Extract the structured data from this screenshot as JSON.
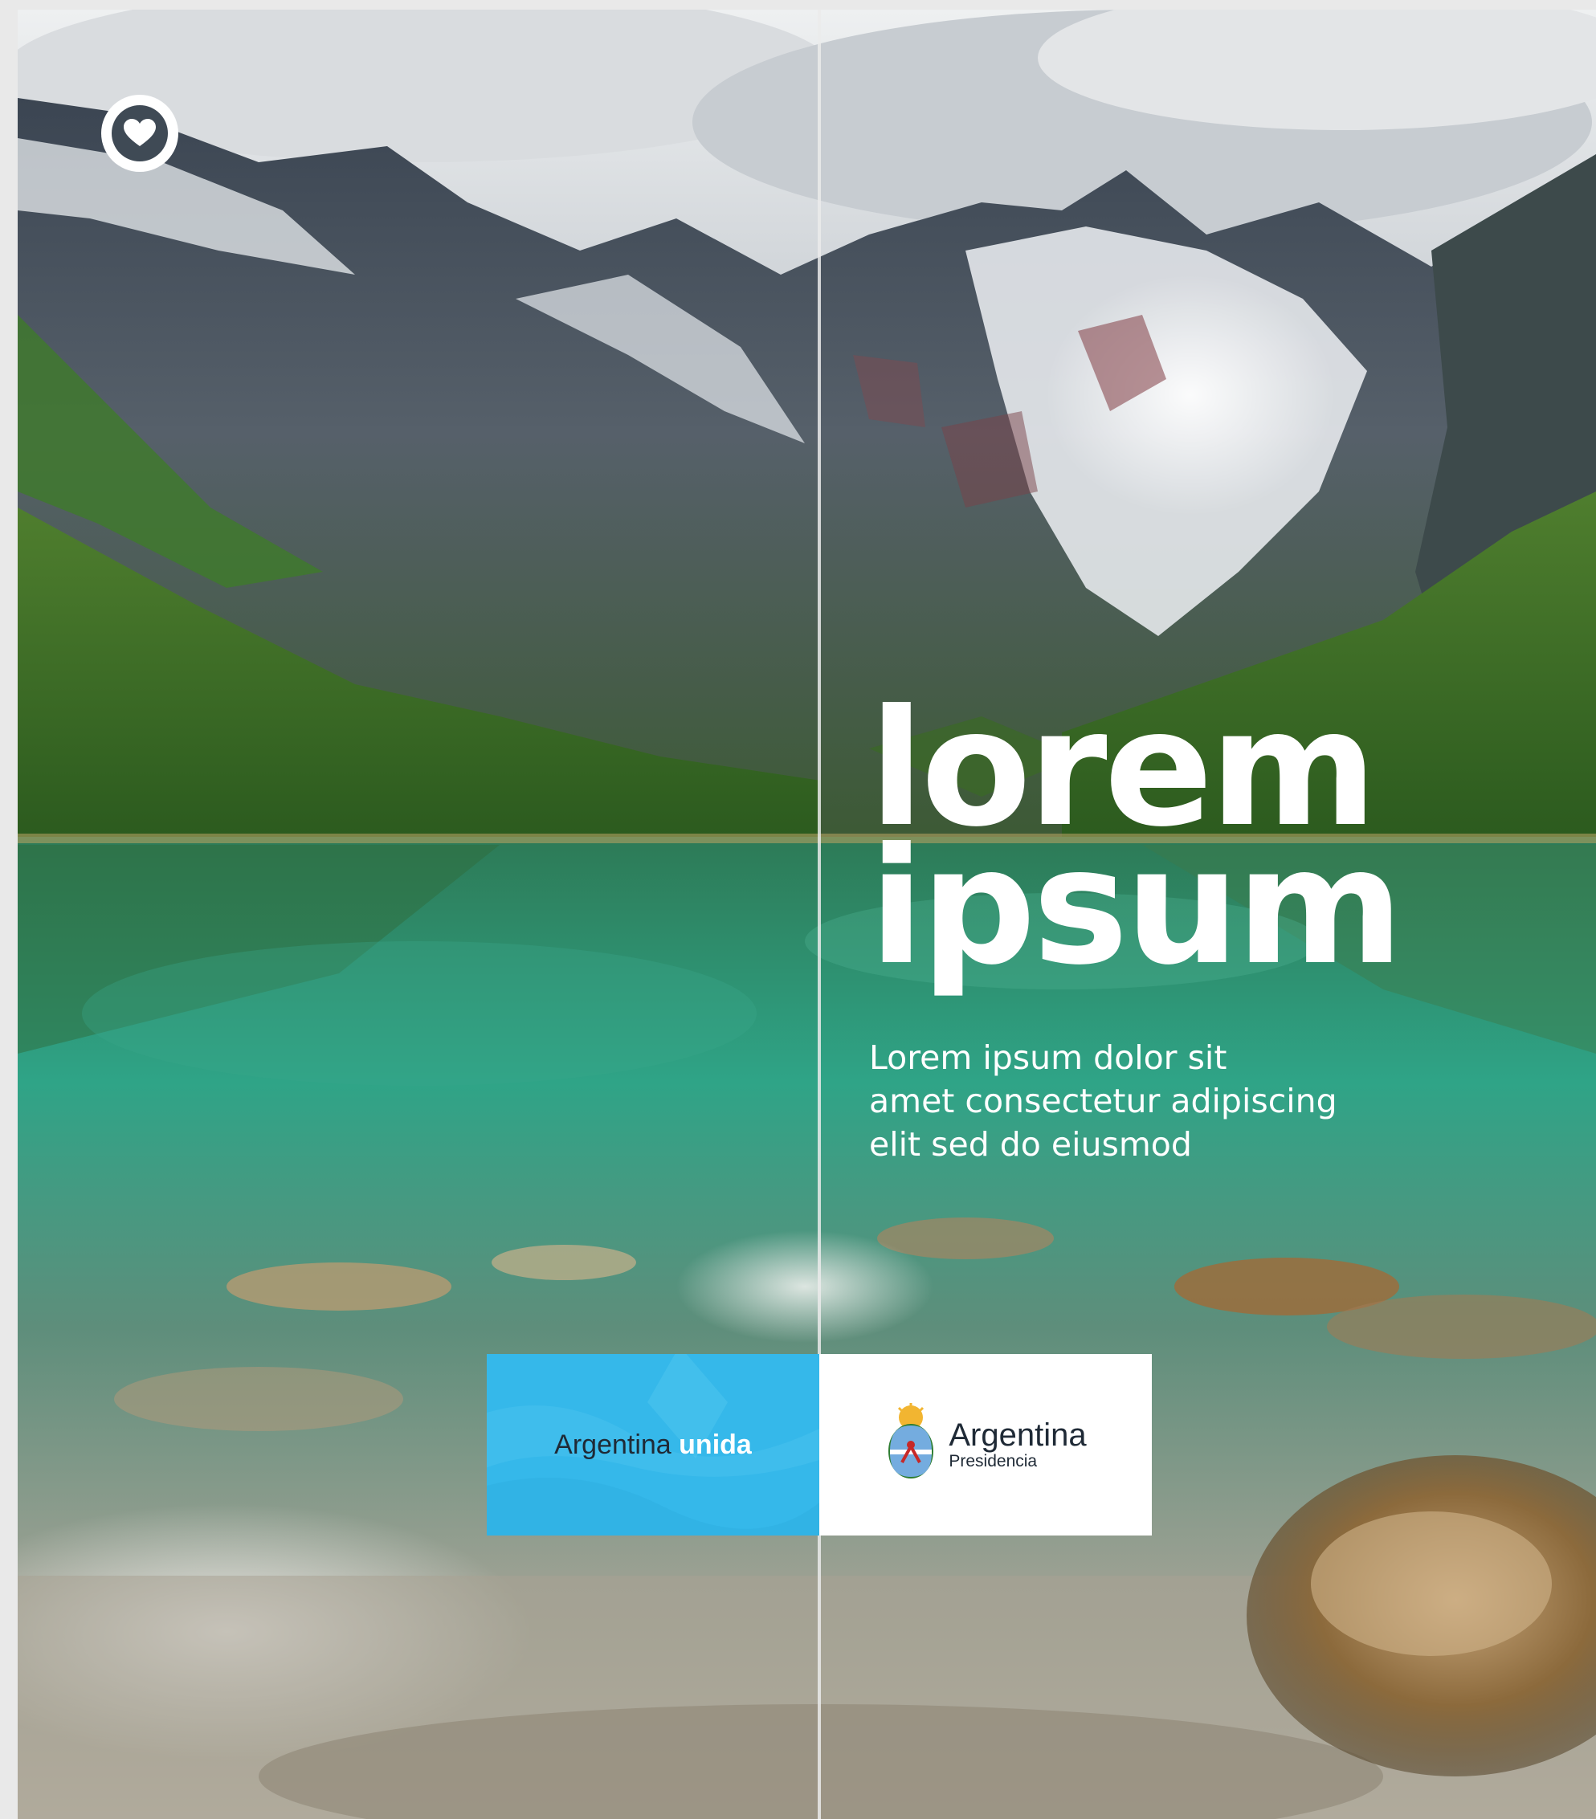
{
  "poster": {
    "headline_line1": "lorem",
    "headline_line2": "ipsum",
    "subtitle_line1": "Lorem ipsum dolor sit",
    "subtitle_line2": "amet consectetur adipiscing",
    "subtitle_line3": "elit sed do eiusmod",
    "badge_icon": "heart-icon"
  },
  "logos": {
    "left": {
      "word1": "Argentina",
      "word2": "unida",
      "background": "#35b8ea"
    },
    "right": {
      "title": "Argentina",
      "subtitle": "Presidencia",
      "emblem_icon": "coat-of-arms-icon"
    }
  },
  "colors": {
    "accent_blue": "#35b8ea",
    "text_dark": "#1f2a36",
    "white": "#ffffff"
  }
}
